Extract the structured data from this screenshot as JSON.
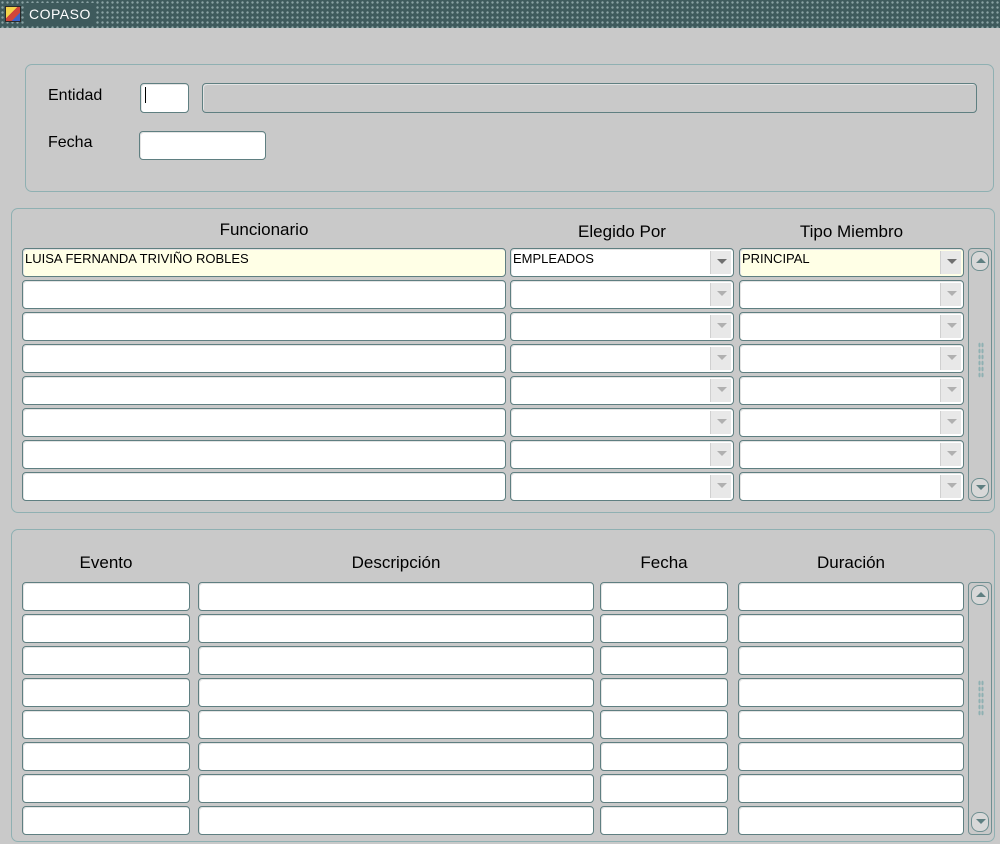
{
  "window": {
    "title": "COPASO"
  },
  "header_panel": {
    "entidad_label": "Entidad",
    "entidad_code": "",
    "entidad_name": "",
    "fecha_label": "Fecha",
    "fecha_value": ""
  },
  "members": {
    "columns": {
      "funcionario": "Funcionario",
      "elegido_por": "Elegido Por",
      "tipo_miembro": "Tipo Miembro"
    },
    "rows": [
      {
        "funcionario": "LUISA FERNANDA TRIVIÑO ROBLES",
        "elegido_por": "EMPLEADOS",
        "tipo_miembro": "PRINCIPAL"
      },
      {
        "funcionario": "",
        "elegido_por": "",
        "tipo_miembro": ""
      },
      {
        "funcionario": "",
        "elegido_por": "",
        "tipo_miembro": ""
      },
      {
        "funcionario": "",
        "elegido_por": "",
        "tipo_miembro": ""
      },
      {
        "funcionario": "",
        "elegido_por": "",
        "tipo_miembro": ""
      },
      {
        "funcionario": "",
        "elegido_por": "",
        "tipo_miembro": ""
      },
      {
        "funcionario": "",
        "elegido_por": "",
        "tipo_miembro": ""
      },
      {
        "funcionario": "",
        "elegido_por": "",
        "tipo_miembro": ""
      }
    ]
  },
  "events": {
    "columns": {
      "evento": "Evento",
      "descripcion": "Descripción",
      "fecha": "Fecha",
      "duracion": "Duración"
    },
    "rows": [
      {
        "evento": "",
        "descripcion": "",
        "fecha": "",
        "duracion": ""
      },
      {
        "evento": "",
        "descripcion": "",
        "fecha": "",
        "duracion": ""
      },
      {
        "evento": "",
        "descripcion": "",
        "fecha": "",
        "duracion": ""
      },
      {
        "evento": "",
        "descripcion": "",
        "fecha": "",
        "duracion": ""
      },
      {
        "evento": "",
        "descripcion": "",
        "fecha": "",
        "duracion": ""
      },
      {
        "evento": "",
        "descripcion": "",
        "fecha": "",
        "duracion": ""
      },
      {
        "evento": "",
        "descripcion": "",
        "fecha": "",
        "duracion": ""
      },
      {
        "evento": "",
        "descripcion": "",
        "fecha": "",
        "duracion": ""
      }
    ]
  },
  "icons": {
    "app": "oracle-forms-window-icon",
    "dropdown": "chevron-down-icon",
    "scroll_up": "scroll-up-icon",
    "scroll_down": "scroll-down-icon"
  },
  "colors": {
    "background": "#c9c9c9",
    "titlebar": "#3e5a5c",
    "panel_border": "#8fb0b2",
    "field_border": "#5f7f81",
    "current_record": "#ffffe6"
  }
}
